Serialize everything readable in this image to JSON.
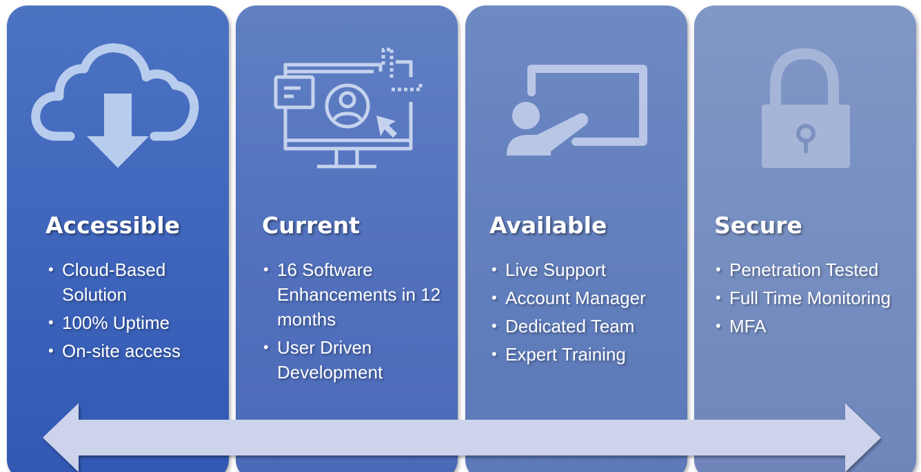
{
  "cards": [
    {
      "title": "Accessible",
      "icon": "cloud-download-icon",
      "bullets": [
        "Cloud-Based Solution",
        "100% Uptime",
        "On-site access"
      ]
    },
    {
      "title": "Current",
      "icon": "monitor-user-icon",
      "bullets": [
        "16 Software Enhancements in 12 months",
        "User Driven Development"
      ]
    },
    {
      "title": "Available",
      "icon": "presenter-board-icon",
      "bullets": [
        "Live Support",
        "Account Manager",
        "Dedicated Team",
        "Expert Training"
      ]
    },
    {
      "title": "Secure",
      "icon": "padlock-icon",
      "bullets": [
        "Penetration Tested",
        "Full Time Monitoring",
        "MFA"
      ]
    }
  ],
  "bullet_glyph": "•",
  "arrow_icon": "double-headed-arrow-icon",
  "colors": {
    "card_1": "#4268bd",
    "card_2": "#5574bf",
    "card_3": "#6481be",
    "card_4": "#7890c2",
    "icon_fill": "#b8cdee",
    "arrow_fill": "#cdd3ea"
  }
}
